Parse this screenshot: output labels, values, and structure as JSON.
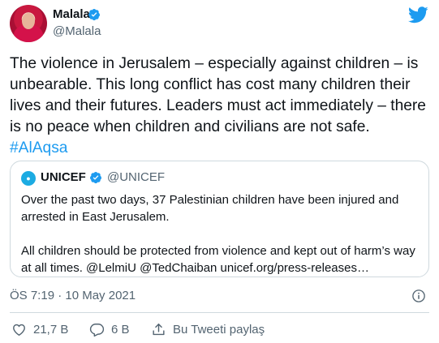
{
  "author": {
    "name": "Malala",
    "handle": "@Malala"
  },
  "tweet": {
    "text": "The violence in Jerusalem – especially against children – is unbearable. This long conflict has cost many children their lives and their futures. Leaders must act immediately – there is no peace when children and civilians are not safe.",
    "hashtag": "#AlAqsa"
  },
  "quote": {
    "logo_text": "unicef",
    "name": "UNICEF",
    "handle": "@UNICEF",
    "paragraph1": "Over the past two days, 37 Palestinian children have been injured and arrested in East Jerusalem.",
    "paragraph2": "All children should be protected from violence and kept out of harm’s way at all times. @LelmiU @TedChaiban unicef.org/press-releases…"
  },
  "timestamp": "ÖS 7:19 · 10 May 2021",
  "actions": {
    "likes": "21,7 B",
    "replies": "6 B",
    "share_label": "Bu Tweeti paylaş"
  },
  "colors": {
    "accent": "#1d9bf0",
    "text": "#0f1419",
    "muted": "#536471",
    "border": "#cfd9de",
    "unicef": "#1cabe2"
  },
  "icons": [
    "twitter-bird-icon",
    "verified-badge-icon",
    "info-icon",
    "heart-icon",
    "reply-icon",
    "share-icon"
  ]
}
